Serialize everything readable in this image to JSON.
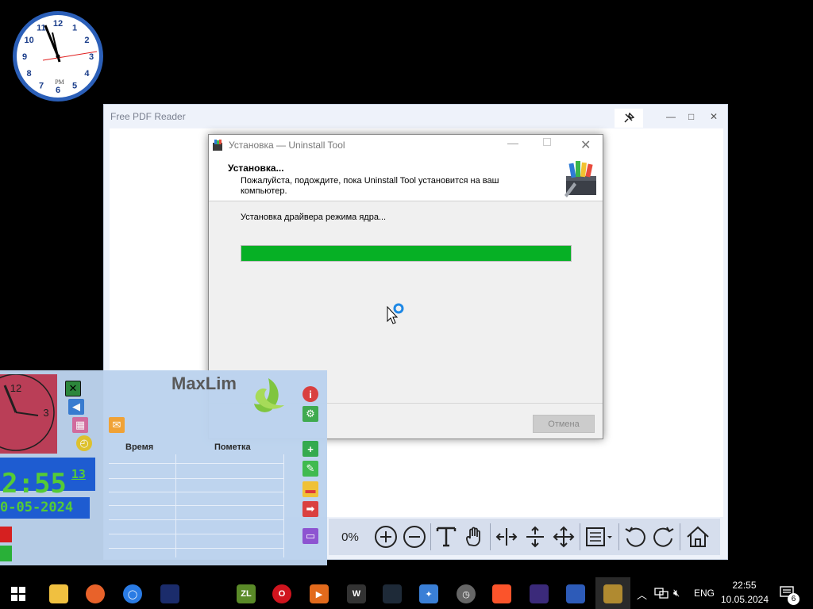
{
  "pdf_reader": {
    "title": "Free PDF Reader",
    "zoom": "0%",
    "controls": {
      "minimize": "—",
      "maximize": "□",
      "close": "✕"
    }
  },
  "installer": {
    "title": "Установка — Uninstall Tool",
    "heading": "Установка...",
    "subheading": "Пожалуйста, подождите, пока Uninstall Tool установится на ваш компьютер.",
    "status": "Установка драйвера режима ядра...",
    "progress": 1.0,
    "progress_color": "#06b025",
    "cancel_label": "Отмена"
  },
  "maxlim": {
    "logo": "MaxLim",
    "col_time": "Время",
    "col_note": "Пометка",
    "digital_time": "2:55",
    "seconds": "13",
    "date": "0-05-2024"
  },
  "desk_clock": {
    "label": "PM",
    "numbers": [
      "12",
      "1",
      "2",
      "3",
      "4",
      "5",
      "6",
      "7",
      "8",
      "9",
      "10",
      "11"
    ]
  },
  "taskbar": {
    "language": "ENG",
    "time": "22:55",
    "date": "10.05.2024",
    "notification_count": "6"
  }
}
